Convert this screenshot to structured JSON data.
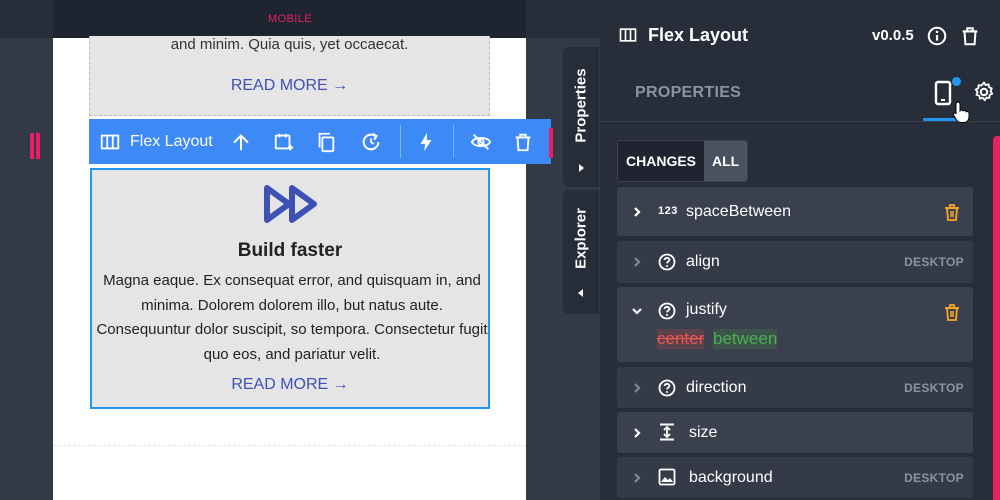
{
  "canvas": {
    "device_label": "MOBILE",
    "card_top": {
      "text": "and minim. Quia quis, yet occaecat.",
      "read_more": "READ MORE →"
    },
    "card_main": {
      "icon": "fast-forward-icon",
      "title": "Build faster",
      "body": "Magna eaque. Ex consequat error, and quisquam in, and minima. Dolorem dolorem illo, but natus aute. Consequuntur dolor suscipit, so tempora. Consectetur fugit quo eos, and pariatur velit.",
      "read_more": "READ MORE →"
    },
    "toolbar": {
      "label": "Flex Layout",
      "icons": [
        "flex-layout-icon",
        "move-up-icon",
        "add-after-icon",
        "duplicate-icon",
        "refresh-icon",
        "actions-bolt-icon",
        "hide-icon",
        "delete-icon"
      ]
    },
    "side_tabs": {
      "properties": "Properties",
      "explorer": "Explorer"
    }
  },
  "panel": {
    "title": "Flex Layout",
    "version": "v0.0.5",
    "tab_properties": "PROPERTIES",
    "filter": {
      "changes": "CHANGES",
      "all": "ALL"
    },
    "properties": [
      {
        "name": "spaceBetween",
        "icon_text": "123",
        "tag": "",
        "has_trash": true,
        "expanded": false
      },
      {
        "name": "align",
        "tag": "DESKTOP",
        "has_trash": false,
        "expanded": false
      },
      {
        "name": "justify",
        "tag": "",
        "has_trash": true,
        "expanded": true,
        "old_value": "center",
        "new_value": "between"
      },
      {
        "name": "direction",
        "tag": "DESKTOP",
        "has_trash": false,
        "expanded": false
      },
      {
        "name": "size",
        "tag": "",
        "has_trash": false,
        "expanded": false
      },
      {
        "name": "background",
        "tag": "DESKTOP",
        "has_trash": false,
        "expanded": false
      }
    ]
  },
  "colors": {
    "accent_blue": "#3d8af7",
    "selection_border": "#2196f3",
    "pink": "#e91e63",
    "link": "#3f51b5",
    "diff_removed": "#ef5350",
    "diff_added": "#4caf50",
    "trash_orange": "#f9a825"
  }
}
